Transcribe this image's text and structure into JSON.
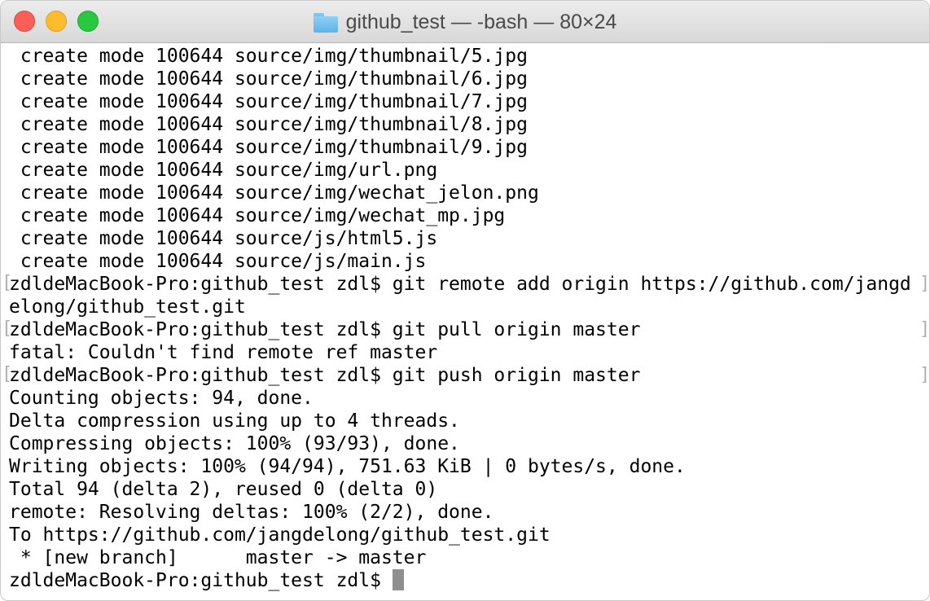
{
  "window": {
    "title": "github_test — -bash — 80×24",
    "icon": "folder-icon"
  },
  "terminal": {
    "lines": [
      " create mode 100644 source/img/thumbnail/5.jpg",
      " create mode 100644 source/img/thumbnail/6.jpg",
      " create mode 100644 source/img/thumbnail/7.jpg",
      " create mode 100644 source/img/thumbnail/8.jpg",
      " create mode 100644 source/img/thumbnail/9.jpg",
      " create mode 100644 source/img/url.png",
      " create mode 100644 source/img/wechat_jelon.png",
      " create mode 100644 source/img/wechat_mp.jpg",
      " create mode 100644 source/js/html5.js",
      " create mode 100644 source/js/main.js",
      "zdldeMacBook-Pro:github_test zdl$ git remote add origin https://github.com/jangd",
      "elong/github_test.git",
      "zdldeMacBook-Pro:github_test zdl$ git pull origin master",
      "fatal: Couldn't find remote ref master",
      "zdldeMacBook-Pro:github_test zdl$ git push origin master",
      "Counting objects: 94, done.",
      "Delta compression using up to 4 threads.",
      "Compressing objects: 100% (93/93), done.",
      "Writing objects: 100% (94/94), 751.63 KiB | 0 bytes/s, done.",
      "Total 94 (delta 2), reused 0 (delta 0)",
      "remote: Resolving deltas: 100% (2/2), done.",
      "To https://github.com/jangdelong/github_test.git",
      " * [new branch]      master -> master",
      "zdldeMacBook-Pro:github_test zdl$ "
    ],
    "cursor_visible": true
  },
  "colors": {
    "close": "#fc5f57",
    "minimize": "#fdbc2e",
    "maximize": "#28c840",
    "text": "#000000"
  }
}
